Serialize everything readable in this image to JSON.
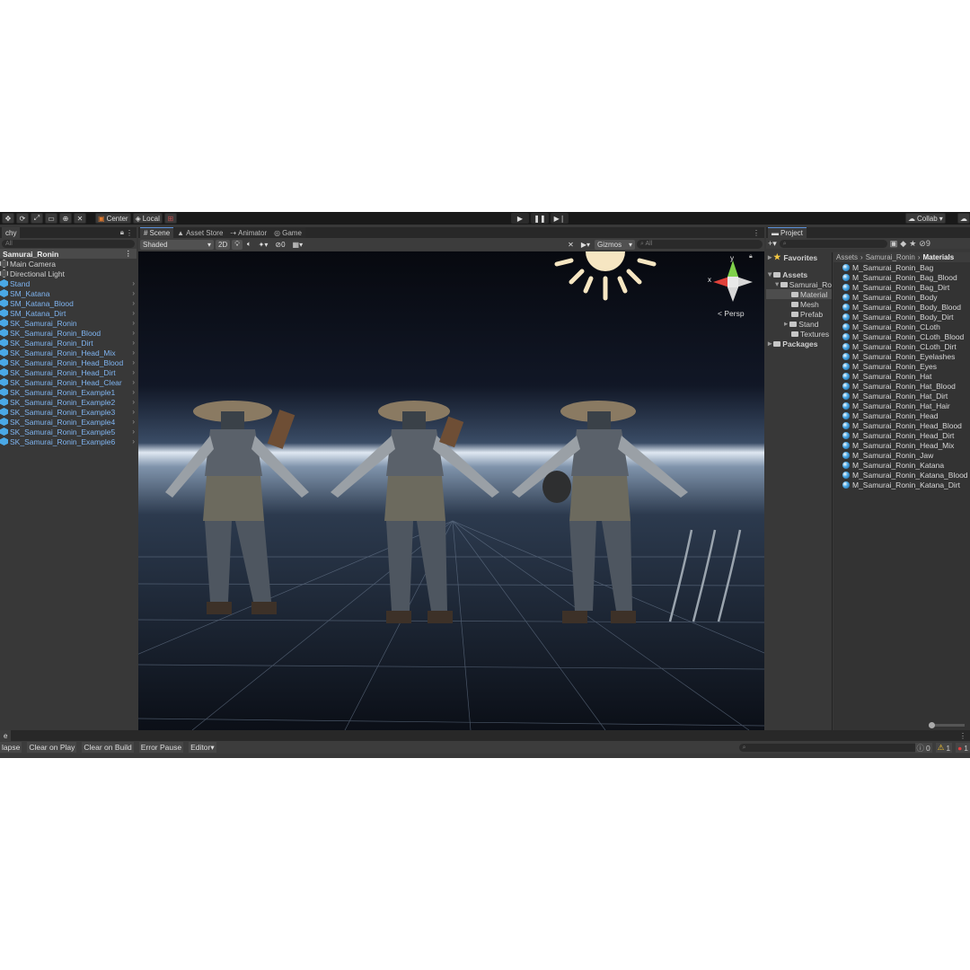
{
  "toolbar": {
    "pivot_center": "Center",
    "pivot_local": "Local",
    "collab": "Collab"
  },
  "hierarchy": {
    "tab_label": "chy",
    "search_placeholder": "All",
    "scene_name": "Samurai_Ronin",
    "items": [
      {
        "label": "Main Camera",
        "kind": "go"
      },
      {
        "label": "Directional Light",
        "kind": "go"
      },
      {
        "label": "Stand",
        "kind": "prefab"
      },
      {
        "label": "SM_Katana",
        "kind": "prefab"
      },
      {
        "label": "SM_Katana_Blood",
        "kind": "prefab"
      },
      {
        "label": "SM_Katana_Dirt",
        "kind": "prefab"
      },
      {
        "label": "SK_Samurai_Ronin",
        "kind": "prefab"
      },
      {
        "label": "SK_Samurai_Ronin_Blood",
        "kind": "prefab"
      },
      {
        "label": "SK_Samurai_Ronin_Dirt",
        "kind": "prefab"
      },
      {
        "label": "SK_Samurai_Ronin_Head_Mix",
        "kind": "prefab"
      },
      {
        "label": "SK_Samurai_Ronin_Head_Blood",
        "kind": "prefab"
      },
      {
        "label": "SK_Samurai_Ronin_Head_Dirt",
        "kind": "prefab"
      },
      {
        "label": "SK_Samurai_Ronin_Head_Clear",
        "kind": "prefab"
      },
      {
        "label": "SK_Samurai_Ronin_Example1",
        "kind": "prefab"
      },
      {
        "label": "SK_Samurai_Ronin_Example2",
        "kind": "prefab"
      },
      {
        "label": "SK_Samurai_Ronin_Example3",
        "kind": "prefab"
      },
      {
        "label": "SK_Samurai_Ronin_Example4",
        "kind": "prefab"
      },
      {
        "label": "SK_Samurai_Ronin_Example5",
        "kind": "prefab"
      },
      {
        "label": "SK_Samurai_Ronin_Example6",
        "kind": "prefab"
      }
    ]
  },
  "scene": {
    "tabs": [
      "Scene",
      "Asset Store",
      "Animator",
      "Game"
    ],
    "shading": "Shaded",
    "mode_2d": "2D",
    "hidden_count": "0",
    "gizmos": "Gizmos",
    "search_placeholder": "All",
    "persp": "Persp",
    "axis_x": "x",
    "axis_y": "y"
  },
  "project": {
    "tab_label": "Project",
    "favorites": "Favorites",
    "assets": "Assets",
    "packages": "Packages",
    "folders": [
      "Samurai_Ro",
      "Material",
      "Mesh",
      "Prefab",
      "Stand",
      "Textures"
    ],
    "breadcrumb": [
      "Assets",
      "Samurai_Ronin",
      "Materials"
    ],
    "materials": [
      "M_Samurai_Ronin_Bag",
      "M_Samurai_Ronin_Bag_Blood",
      "M_Samurai_Ronin_Bag_Dirt",
      "M_Samurai_Ronin_Body",
      "M_Samurai_Ronin_Body_Blood",
      "M_Samurai_Ronin_Body_Dirt",
      "M_Samurai_Ronin_CLoth",
      "M_Samurai_Ronin_CLoth_Blood",
      "M_Samurai_Ronin_CLoth_Dirt",
      "M_Samurai_Ronin_Eyelashes",
      "M_Samurai_Ronin_Eyes",
      "M_Samurai_Ronin_Hat",
      "M_Samurai_Ronin_Hat_Blood",
      "M_Samurai_Ronin_Hat_Dirt",
      "M_Samurai_Ronin_Hat_Hair",
      "M_Samurai_Ronin_Head",
      "M_Samurai_Ronin_Head_Blood",
      "M_Samurai_Ronin_Head_Dirt",
      "M_Samurai_Ronin_Head_Mix",
      "M_Samurai_Ronin_Jaw",
      "M_Samurai_Ronin_Katana",
      "M_Samurai_Ronin_Katana_Blood",
      "M_Samurai_Ronin_Katana_Dirt"
    ],
    "hidden_packages_count": "9"
  },
  "console": {
    "tab_label": "e",
    "buttons": [
      "lapse",
      "Clear on Play",
      "Clear on Build",
      "Error Pause",
      "Editor"
    ],
    "log_count": "0",
    "warn_count": "1",
    "error_count": "1"
  },
  "colors": {
    "accent": "#5a8fd8",
    "prefab_text": "#7fb4f0",
    "panel_bg": "#383838",
    "toolbar_bg": "#191919"
  }
}
